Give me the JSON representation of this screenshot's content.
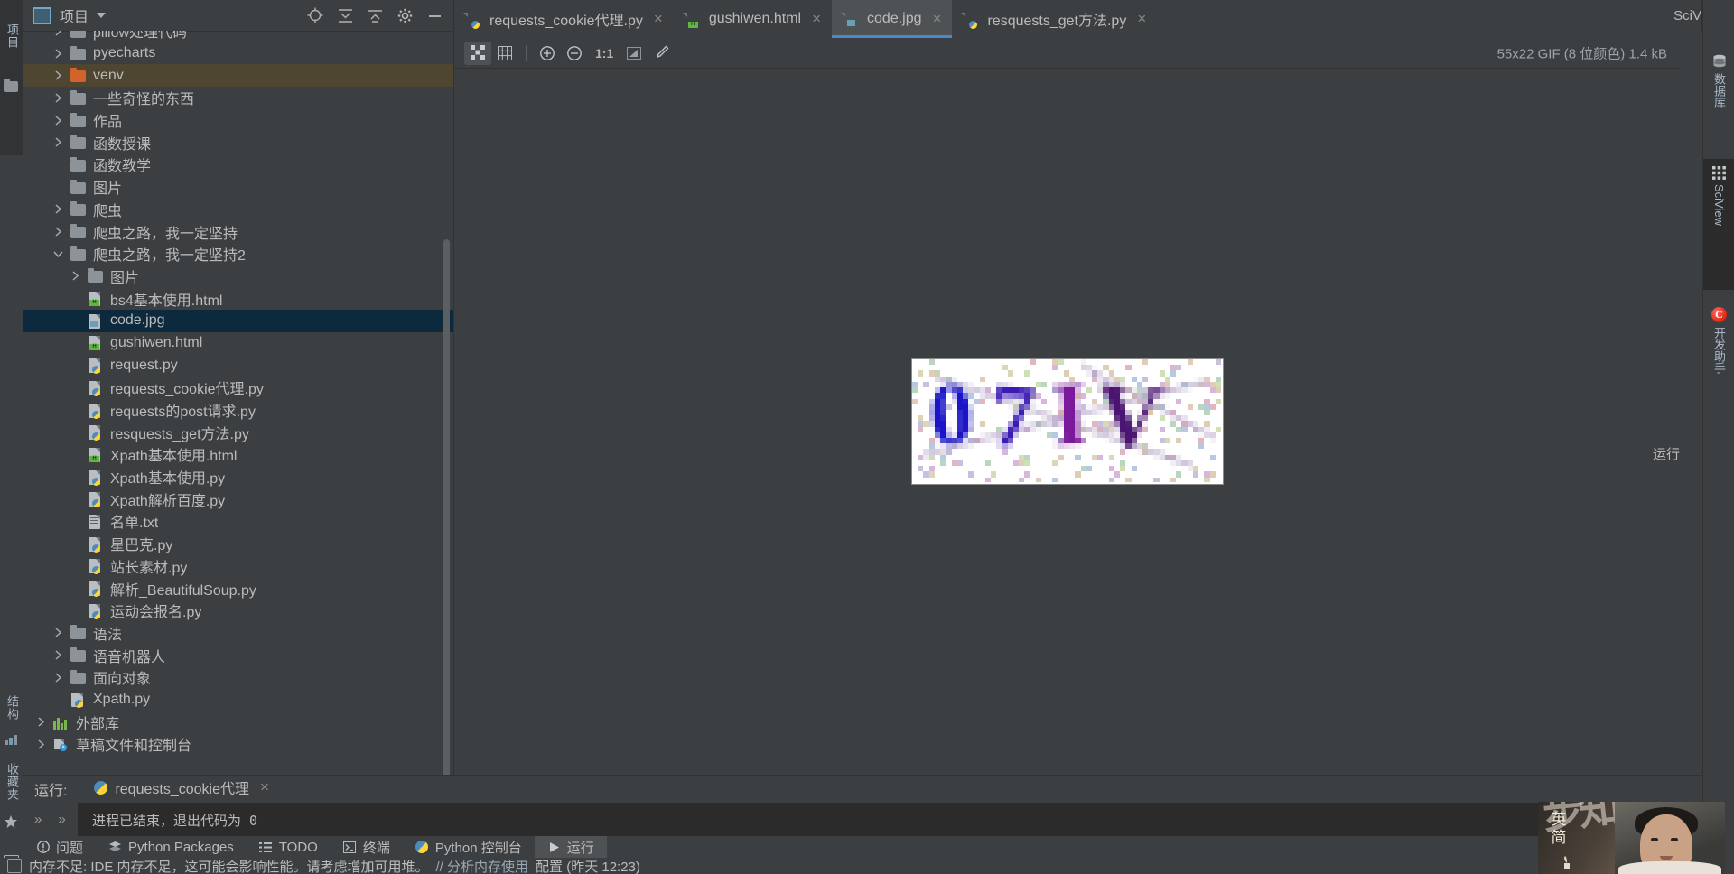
{
  "left_strip": {
    "project_label": "项目",
    "structure_label": "结构",
    "favorites_label": "收藏夹",
    "icons": [
      "project-tool-icon",
      "folder-icon",
      "structure-icon",
      "star-icon",
      "terminal-icon"
    ]
  },
  "project_panel": {
    "title": "项目",
    "actions": [
      "locate-icon",
      "collapse-all-icon",
      "expand-icon",
      "settings-gear-icon",
      "minimize-icon"
    ],
    "tree": [
      {
        "label": "pillow处理代码",
        "type": "folder",
        "depth": 1,
        "arrow": "right",
        "clipped": true
      },
      {
        "label": "pyecharts",
        "type": "folder",
        "depth": 1,
        "arrow": "right"
      },
      {
        "label": "venv",
        "type": "folder-orange",
        "depth": 1,
        "arrow": "right",
        "highlight": "olive"
      },
      {
        "label": "一些奇怪的东西",
        "type": "folder",
        "depth": 1,
        "arrow": "right"
      },
      {
        "label": "作品",
        "type": "folder",
        "depth": 1,
        "arrow": "right"
      },
      {
        "label": "函数授课",
        "type": "folder",
        "depth": 1,
        "arrow": "right"
      },
      {
        "label": "函数教学",
        "type": "folder",
        "depth": 1,
        "arrow": "none"
      },
      {
        "label": "图片",
        "type": "folder",
        "depth": 1,
        "arrow": "none"
      },
      {
        "label": "爬虫",
        "type": "folder",
        "depth": 1,
        "arrow": "right"
      },
      {
        "label": "爬虫之路，我一定坚持",
        "type": "folder",
        "depth": 1,
        "arrow": "right"
      },
      {
        "label": "爬虫之路，我一定坚持2",
        "type": "folder",
        "depth": 1,
        "arrow": "down"
      },
      {
        "label": "图片",
        "type": "folder",
        "depth": 2,
        "arrow": "right"
      },
      {
        "label": "bs4基本使用.html",
        "type": "html",
        "depth": 2,
        "arrow": "none"
      },
      {
        "label": "code.jpg",
        "type": "image",
        "depth": 2,
        "arrow": "none",
        "highlight": "blue"
      },
      {
        "label": "gushiwen.html",
        "type": "html",
        "depth": 2,
        "arrow": "none"
      },
      {
        "label": "request.py",
        "type": "python",
        "depth": 2,
        "arrow": "none"
      },
      {
        "label": "requests_cookie代理.py",
        "type": "python",
        "depth": 2,
        "arrow": "none"
      },
      {
        "label": "requests的post请求.py",
        "type": "python",
        "depth": 2,
        "arrow": "none"
      },
      {
        "label": "resquests_get方法.py",
        "type": "python",
        "depth": 2,
        "arrow": "none"
      },
      {
        "label": "Xpath基本使用.html",
        "type": "html",
        "depth": 2,
        "arrow": "none"
      },
      {
        "label": "Xpath基本使用.py",
        "type": "python",
        "depth": 2,
        "arrow": "none"
      },
      {
        "label": "Xpath解析百度.py",
        "type": "python",
        "depth": 2,
        "arrow": "none"
      },
      {
        "label": "名单.txt",
        "type": "text",
        "depth": 2,
        "arrow": "none"
      },
      {
        "label": "星巴克.py",
        "type": "python",
        "depth": 2,
        "arrow": "none"
      },
      {
        "label": "站长素材.py",
        "type": "python",
        "depth": 2,
        "arrow": "none"
      },
      {
        "label": "解析_BeautifulSoup.py",
        "type": "python",
        "depth": 2,
        "arrow": "none"
      },
      {
        "label": "运动会报名.py",
        "type": "python",
        "depth": 2,
        "arrow": "none"
      },
      {
        "label": "语法",
        "type": "folder",
        "depth": 1,
        "arrow": "right"
      },
      {
        "label": "语音机器人",
        "type": "folder",
        "depth": 1,
        "arrow": "right"
      },
      {
        "label": "面向对象",
        "type": "folder",
        "depth": 1,
        "arrow": "right"
      },
      {
        "label": "Xpath.py",
        "type": "python",
        "depth": 1,
        "arrow": "none"
      },
      {
        "label": "外部库",
        "type": "extlib",
        "depth": 0,
        "arrow": "right"
      },
      {
        "label": "草稿文件和控制台",
        "type": "scratch",
        "depth": 0,
        "arrow": "right"
      }
    ]
  },
  "tabs": [
    {
      "label": "requests_cookie代理.py",
      "icon": "python-file-icon",
      "active": false,
      "close": "×"
    },
    {
      "label": "gushiwen.html",
      "icon": "html-file-icon",
      "active": false,
      "close": "×"
    },
    {
      "label": "code.jpg",
      "icon": "image-file-icon",
      "active": true,
      "close": "×"
    },
    {
      "label": "resquests_get方法.py",
      "icon": "python-file-icon",
      "active": false,
      "close": "×"
    }
  ],
  "image_editor": {
    "toolbar": [
      {
        "name": "transparency-chessboard-icon",
        "active": true
      },
      {
        "name": "grid-icon",
        "active": false
      },
      {
        "name": "zoom-in-icon",
        "active": false
      },
      {
        "name": "zoom-out-icon",
        "active": false
      },
      {
        "name": "actual-size-label",
        "label": "1:1",
        "active": false
      },
      {
        "name": "fit-to-window-icon",
        "active": false
      },
      {
        "name": "color-picker-icon",
        "active": false
      }
    ],
    "info": "55x22 GIF (8 位颜色) 1.4 kB",
    "captcha_text": "07IV",
    "right_edge_label": "运行"
  },
  "right_strip": {
    "sciview_top_label": "SciV",
    "items": [
      {
        "label": "数据库",
        "icon": "database-icon",
        "active": false
      },
      {
        "label": "SciView",
        "icon": "grid-table-icon",
        "active": true
      },
      {
        "label": "开发助手",
        "icon": "assistant-c-icon",
        "active": false
      }
    ]
  },
  "run_panel": {
    "title": "运行:",
    "tab_label": "requests_cookie代理",
    "tab_close": "×",
    "output": "进程已结束，退出代码为  0",
    "gutter": [
      "»",
      "»"
    ]
  },
  "bottom_bar": {
    "items": [
      {
        "label": "问题",
        "icon": "warning-circle-icon",
        "active": false
      },
      {
        "label": "Python Packages",
        "icon": "packages-icon",
        "active": false
      },
      {
        "label": "TODO",
        "icon": "todo-list-icon",
        "active": false
      },
      {
        "label": "终端",
        "icon": "terminal-icon",
        "active": false
      },
      {
        "label": "Python 控制台",
        "icon": "python-console-icon",
        "active": false
      },
      {
        "label": "运行",
        "icon": "run-play-icon",
        "active": true
      }
    ]
  },
  "status_bar": {
    "icon": "memory-indicator-icon",
    "text": "内存不足: IDE 内存不足，这可能会影响性能。请考虑增加可用堆。",
    "link1": "// 分析内存使用",
    "link2": "配置 (昨天 12:23)"
  },
  "webcam_overlay": {
    "watermark": "步知情",
    "badge_line1": "英",
    "badge_line2": "简"
  },
  "colors": {
    "bg": "#3c3f41",
    "panel_dark": "#2b2b2b",
    "selection_blue": "#0d293e",
    "selection_olive": "#4e4631",
    "accent_blue": "#4a88c7",
    "text": "#bbbbbb",
    "folder": "#8d9499",
    "folder_orange": "#d2632a",
    "html_green": "#62b543",
    "red_accent": "#e02f1f"
  }
}
